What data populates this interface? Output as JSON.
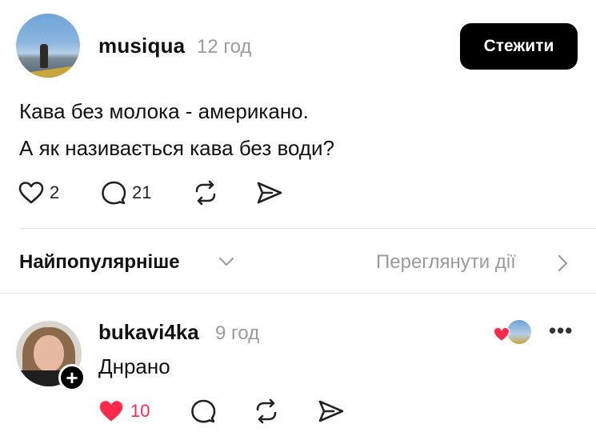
{
  "post": {
    "username": "musiqua",
    "time": "12 год",
    "follow_label": "Стежити",
    "text_lines": [
      "Кава без молока - американо.",
      "А як називається кава без води?"
    ],
    "actions": {
      "likes": "2",
      "replies": "21"
    }
  },
  "sort": {
    "label": "Найпопулярніше",
    "activity_link": "Переглянути дії"
  },
  "comment": {
    "username": "bukavi4ka",
    "time": "9 год",
    "text": "Днрано",
    "follow_badge": "+",
    "more": "•••",
    "actions": {
      "likes": "10",
      "liked": true
    }
  },
  "colors": {
    "primary_text": "#111111",
    "muted_text": "#9a9a9a",
    "button_bg": "#000000",
    "button_text": "#ffffff",
    "like_red": "#ff2b4d",
    "divider": "#e3e3e3"
  },
  "icons": [
    "heart-icon",
    "comment-icon",
    "repost-icon",
    "share-icon",
    "chevron-down-icon",
    "chevron-right-icon",
    "more-icon",
    "plus-icon"
  ]
}
